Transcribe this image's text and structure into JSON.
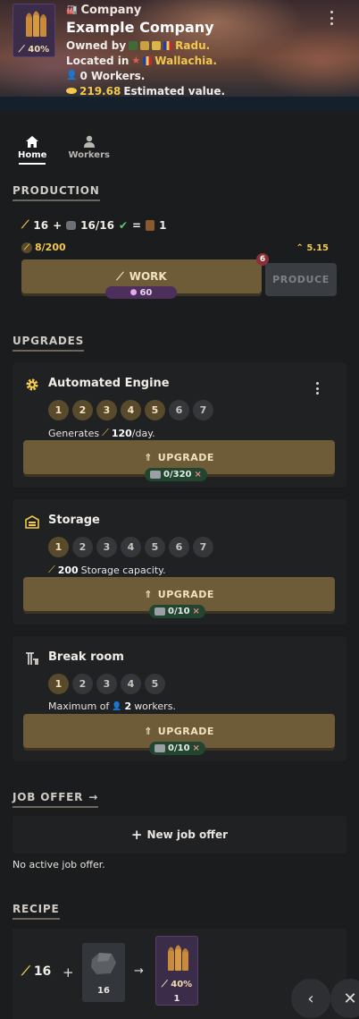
{
  "header": {
    "category": "Company",
    "name": "Example Company",
    "thumb_quality": "40%",
    "owned_by_label": "Owned by",
    "owner_name": "Radu.",
    "located_in_label": "Located in",
    "location": "Wallachia.",
    "workers_text": "0 Workers.",
    "estimated_value": "219.68",
    "estimated_value_label": "Estimated value."
  },
  "tabs": [
    {
      "label": "Home",
      "active": true
    },
    {
      "label": "Workers",
      "active": false
    }
  ],
  "production": {
    "title": "PRODUCTION",
    "work_input": "16",
    "material_input": "16/16",
    "output_qty": "1",
    "storage": "8/200",
    "rate": "5.15",
    "work_label": "WORK",
    "work_badge": "6",
    "energy_cost": "60",
    "produce_label": "PRODUCE"
  },
  "upgrades": {
    "title": "UPGRADES",
    "items": [
      {
        "name": "Automated Engine",
        "icon": "gear-icon",
        "levels": [
          "1",
          "2",
          "3",
          "4",
          "5",
          "6",
          "7"
        ],
        "active_levels": 5,
        "desc_prefix": "Generates",
        "desc_value": "120",
        "desc_suffix": "/day.",
        "button_label": "UPGRADE",
        "cost": "0/320"
      },
      {
        "name": "Storage",
        "icon": "warehouse-icon",
        "levels": [
          "1",
          "2",
          "3",
          "4",
          "5",
          "6",
          "7"
        ],
        "active_levels": 1,
        "desc_prefix": "",
        "desc_value": "200",
        "desc_suffix": "Storage capacity.",
        "button_label": "UPGRADE",
        "cost": "0/10"
      },
      {
        "name": "Break room",
        "icon": "break-room-icon",
        "levels": [
          "1",
          "2",
          "3",
          "4",
          "5"
        ],
        "active_levels": 1,
        "desc_prefix": "Maximum of",
        "desc_value": "2",
        "desc_suffix": "workers.",
        "button_label": "UPGRADE",
        "cost": "0/10"
      }
    ]
  },
  "job_offer": {
    "title": "JOB OFFER",
    "new_label": "New job offer",
    "empty_text": "No active job offer."
  },
  "recipe": {
    "title": "RECIPE",
    "work": "16",
    "input_qty": "16",
    "output_quality": "40%",
    "output_qty": "1"
  },
  "colors": {
    "accent_gold": "#f2c94c",
    "button_gold": "#6e5b38",
    "energy_purple": "#4d2f5c"
  }
}
